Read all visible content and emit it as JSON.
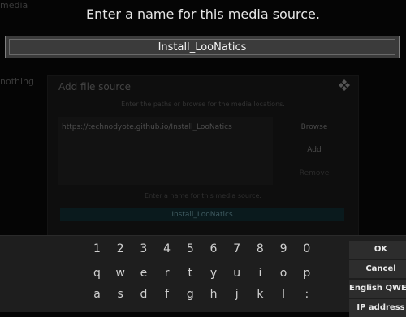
{
  "background": {
    "label_top": "media",
    "label_side": "nothing"
  },
  "prompt": {
    "title": "Enter a name for this media source.",
    "value": "Install_LooNatics"
  },
  "dialog": {
    "title": "Add file source",
    "hint": "Enter the paths or browse for the media locations.",
    "path": "https://technodyote.github.io/Install_LooNatics",
    "browse": "Browse",
    "add": "Add",
    "remove": "Remove",
    "name_hint": "Enter a name for this media source.",
    "name_value": "Install_LooNatics"
  },
  "keyboard": {
    "rows": [
      [
        "1",
        "2",
        "3",
        "4",
        "5",
        "6",
        "7",
        "8",
        "9",
        "0"
      ],
      [
        "q",
        "w",
        "e",
        "r",
        "t",
        "y",
        "u",
        "i",
        "o",
        "p"
      ],
      [
        "a",
        "s",
        "d",
        "f",
        "g",
        "h",
        "j",
        "k",
        "l",
        ":"
      ]
    ],
    "ok": "OK",
    "cancel": "Cancel",
    "layout": "English QWERTY",
    "ip": "IP address"
  }
}
